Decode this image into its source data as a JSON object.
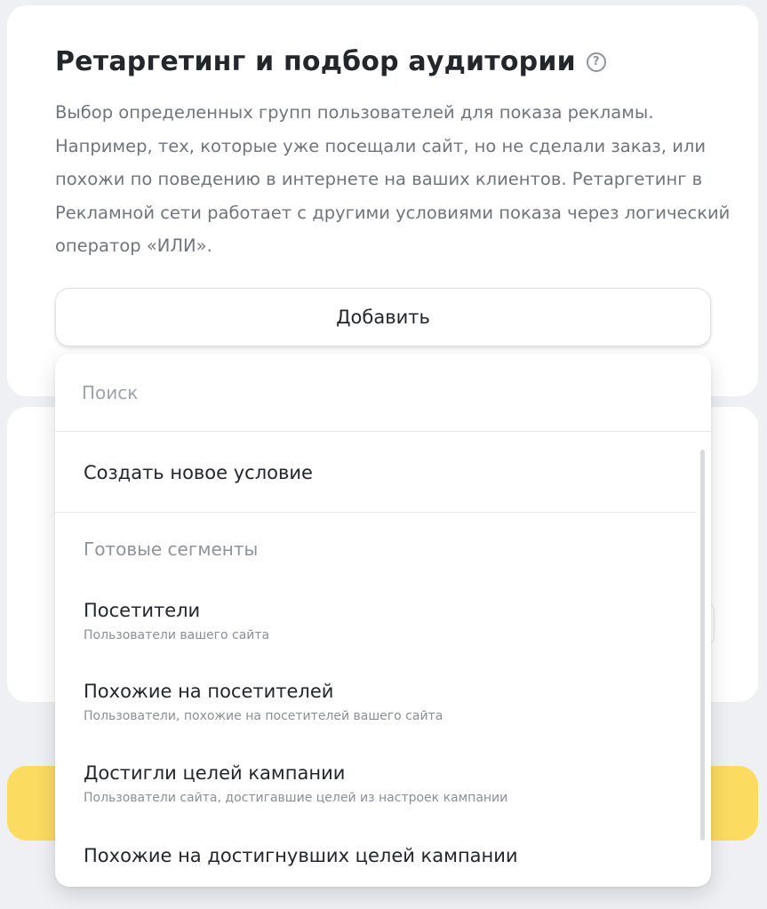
{
  "section": {
    "title": "Ретаргетинг и подбор аудитории",
    "help_glyph": "?",
    "description": "Выбор определенных групп пользователей для показа рекламы. Например, тех, которые уже посещали сайт, но не сделали заказ, или похожи по поведению в интернете на ваших клиентов. Ретаргетинг в Рекламной сети работает с другими условиями показа через логический оператор «ИЛИ».",
    "add_button_label": "Добавить"
  },
  "dropdown": {
    "search_placeholder": "Поиск",
    "create_item_label": "Создать новое условие",
    "group_header": "Готовые сегменты",
    "segments": [
      {
        "label": "Посетители",
        "sublabel": "Пользователи вашего сайта"
      },
      {
        "label": "Похожие на посетителей",
        "sublabel": "Пользователи, похожие на посетителей вашего сайта"
      },
      {
        "label": "Достигли целей кампании",
        "sublabel": "Пользователи сайта, достигавшие целей из настроек кампании"
      },
      {
        "label": "Похожие на достигнувших целей кампании",
        "sublabel": ""
      }
    ]
  },
  "colors": {
    "background": "#eef0f4",
    "card": "#ffffff",
    "accent_yellow": "#fbdb60",
    "text_primary": "#23262b",
    "text_secondary": "#70757c"
  },
  "icons": {
    "help": "question-circle-icon"
  }
}
